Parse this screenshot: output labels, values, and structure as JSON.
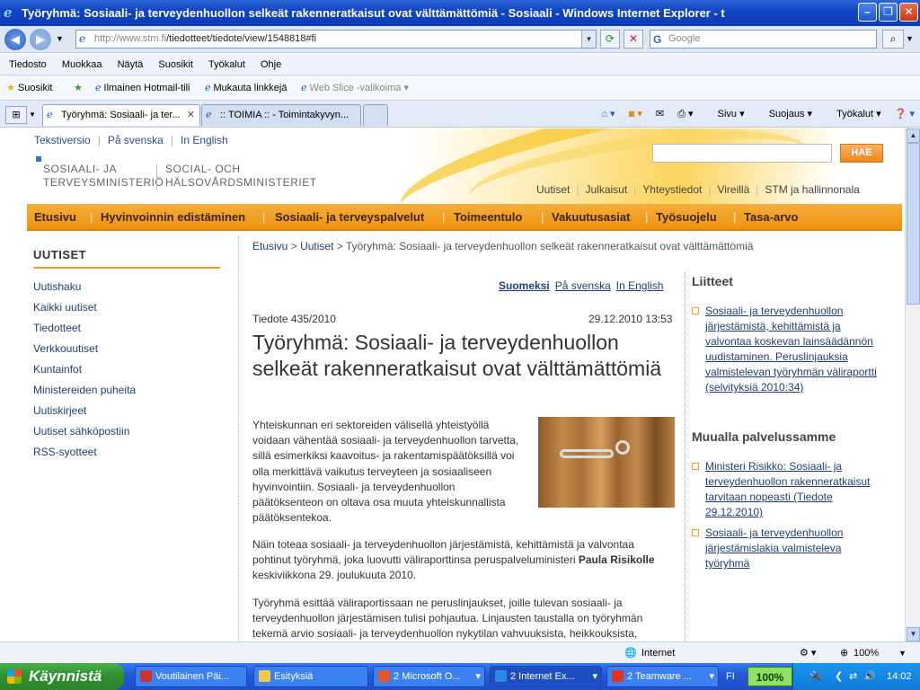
{
  "window": {
    "title": "Työryhmä: Sosiaali- ja terveydenhuollon selkeät rakenneratkaisut ovat välttämättömiä - Sosiaali - Windows Internet Explorer - t"
  },
  "address": {
    "url_prefix": "http://www.stm.fi",
    "url_rest": "/tiedotteet/tiedote/view/1548818#fi",
    "search_placeholder": "Google"
  },
  "menu": [
    "Tiedosto",
    "Muokkaa",
    "Näytä",
    "Suosikit",
    "Työkalut",
    "Ohje"
  ],
  "favorites": {
    "label": "Suosikit",
    "items": [
      "Ilmainen Hotmail-tili",
      "Mukauta linkkejä",
      "Web Slice -valikoima"
    ]
  },
  "tabs": [
    {
      "label": "Työryhmä: Sosiaali- ja ter..."
    },
    {
      "label": ":: TOIMIA :: - Toimintakyvyn..."
    }
  ],
  "commands": [
    "Sivu",
    "Suojaus",
    "Työkalut"
  ],
  "site": {
    "lang_links": [
      "Tekstiversio",
      "På svenska",
      "In English"
    ],
    "logo_fi": [
      "SOSIAALI- JA",
      "TERVEYSMINISTERIÖ"
    ],
    "logo_sv": [
      "SOCIAL- OCH",
      "HÄLSOVÅRDSMINISTERIET"
    ],
    "search_button": "HAE",
    "top_links": [
      "Uutiset",
      "Julkaisut",
      "Yhteystiedot",
      "Vireillä",
      "STM ja hallinnonala"
    ],
    "main_nav": [
      "Etusivu",
      "Hyvinvoinnin edistäminen",
      "Sosiaali- ja terveyspalvelut",
      "Toimeentulo",
      "Vakuutusasiat",
      "Työsuojelu",
      "Tasa-arvo"
    ]
  },
  "left_nav": {
    "heading": "UUTISET",
    "items": [
      "Uutishaku",
      "Kaikki uutiset",
      "Tiedotteet",
      "Verkkouutiset",
      "Kuntainfot",
      "Ministereiden puheita",
      "Uutiskirjeet",
      "Uutiset sähköpostiin",
      "RSS-syotteet"
    ]
  },
  "breadcrumb": {
    "home": "Etusivu",
    "news": "Uutiset",
    "current": "Työryhmä: Sosiaali- ja terveydenhuollon selkeät rakenneratkaisut ovat välttämättömiä",
    "sep": ">"
  },
  "article": {
    "langs": [
      "Suomeksi",
      "På svenska",
      "In English"
    ],
    "number": "Tiedote 435/2010",
    "date": "29.12.2010 13:53",
    "title": "Työryhmä: Sosiaali- ja terveydenhuollon selkeät rakenneratkaisut ovat välttämättömiä",
    "p1": "Yhteiskunnan eri sektoreiden välisellä yhteistyöllä voidaan vähentää sosiaali- ja terveydenhuollon tarvetta, sillä esimerkiksi kaavoitus- ja rakentamispäätöksillä voi olla merkittävä vaikutus terveyteen ja sosiaaliseen hyvinvointiin. Sosiaali- ja terveydenhuollon päätöksenteon on oltava osa muuta yhteiskunnallista päätöksentekoa.",
    "p2_a": "Näin toteaa sosiaali- ja terveydenhuollon järjestämistä, kehittämistä ja valvontaa pohtinut työryhmä, joka luovutti väliraporttinsa peruspalveluministeri ",
    "p2_name": "Paula Risikolle",
    "p2_b": " keskiviikkona 29. joulukuuta 2010.",
    "p3": "Työryhmä esittää väliraportissaan ne peruslinjaukset, joille tulevan sosiaali- ja terveydenhuollon järjestämisen tulisi pohjautua. Linjausten taustalla on työryhmän tekemä arvio sosiaali- ja terveydenhuollon nykytilan vahvuuksista, heikkouksista,"
  },
  "right": {
    "attachments_title": "Liitteet",
    "attachments": [
      "Sosiaali- ja terveydenhuollon järjestämistä, kehittämistä ja valvontaa koskevan lainsäädännön uudistaminen. Peruslinjauksia valmistelevan työryhmän väliraportti (selvityksiä 2010:34)"
    ],
    "elsewhere_title": "Muualla palvelussamme",
    "elsewhere": [
      "Ministeri Risikko: Sosiaali- ja terveydenhuollon rakenneratkaisut tarvitaan nopeasti (Tiedote 29.12.2010)",
      "Sosiaali- ja terveydenhuollon järjestämislakia valmisteleva työryhmä"
    ]
  },
  "status": {
    "zone": "Internet",
    "zoom": "100%"
  },
  "taskbar": {
    "start": "Käynnistä",
    "tasks": [
      "Voutilainen Päi...",
      "Esityksiä",
      "2 Microsoft O...",
      "2 Internet Ex...",
      "2 Teamware ..."
    ],
    "lang": "FI",
    "zoom": "100%",
    "time": "14:02"
  }
}
